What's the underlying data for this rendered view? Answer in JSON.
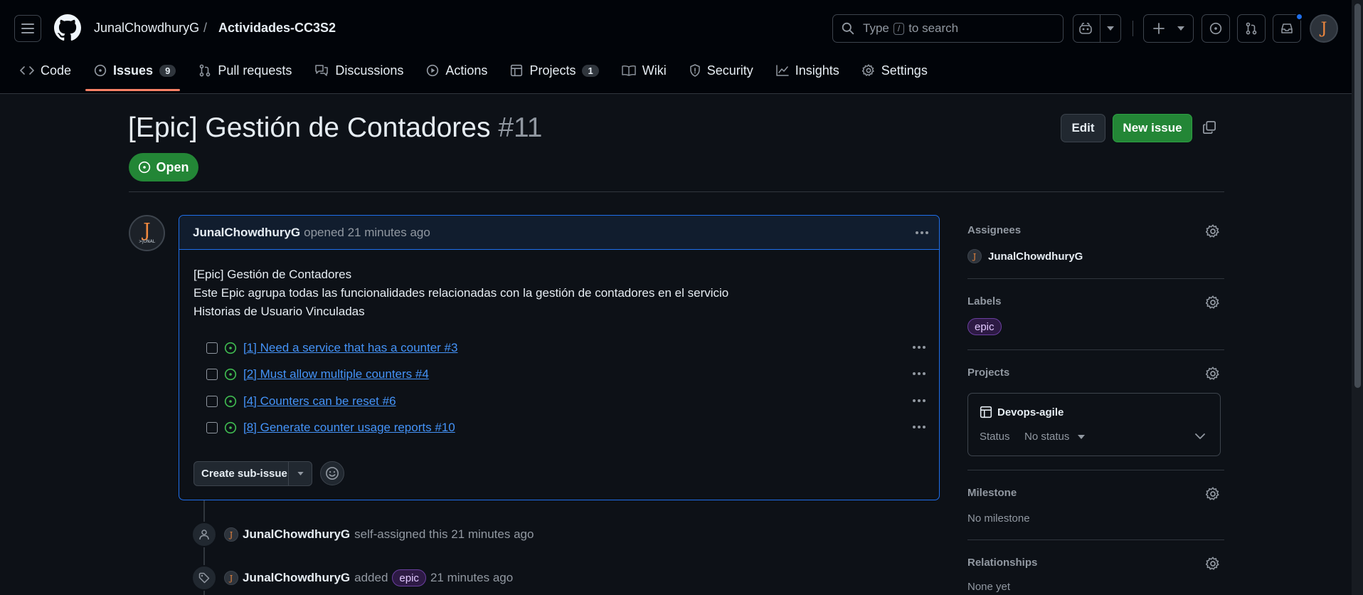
{
  "header": {
    "owner": "JunalChowdhuryG",
    "separator": "/",
    "repo": "Actividades-CC3S2",
    "search_prefix": "Type",
    "search_key": "/",
    "search_suffix": "to search"
  },
  "tabs": [
    {
      "label": "Code",
      "icon": "code-icon"
    },
    {
      "label": "Issues",
      "count": "9",
      "icon": "issue-open-icon",
      "active": true
    },
    {
      "label": "Pull requests",
      "icon": "pull-request-icon"
    },
    {
      "label": "Discussions",
      "icon": "discussion-icon"
    },
    {
      "label": "Actions",
      "icon": "play-icon"
    },
    {
      "label": "Projects",
      "count": "1",
      "icon": "table-icon"
    },
    {
      "label": "Wiki",
      "icon": "book-icon"
    },
    {
      "label": "Security",
      "icon": "shield-icon"
    },
    {
      "label": "Insights",
      "icon": "graph-icon"
    },
    {
      "label": "Settings",
      "icon": "gear-icon"
    }
  ],
  "issue": {
    "title": "[Epic] Gestión de Contadores",
    "number": "#11",
    "state": "Open",
    "edit_label": "Edit",
    "new_issue_label": "New issue"
  },
  "comment": {
    "author": "JunalChowdhuryG",
    "meta": "opened 21 minutes ago",
    "avatar_letter": "J",
    "avatar_sub": ">JUNAL",
    "lines": [
      "[Epic] Gestión de Contadores",
      "Este Epic agrupa todas las funcionalidades relacionadas con la gestión de contadores en el servicio",
      "Historias de Usuario Vinculadas"
    ],
    "tasks": [
      "[1] Need a service that has a counter #3",
      "[2] Must allow multiple counters #4",
      "[4] Counters can be reset #6",
      "[8] Generate counter usage reports #10"
    ],
    "create_sub_issue_label": "Create sub-issue"
  },
  "timeline": [
    {
      "author": "JunalChowdhuryG",
      "action": "self-assigned this 21 minutes ago"
    },
    {
      "author": "JunalChowdhuryG",
      "action_before": "added",
      "label": "epic",
      "action_after": "21 minutes ago"
    }
  ],
  "sidebar": {
    "assignees_title": "Assignees",
    "assignee": "JunalChowdhuryG",
    "labels_title": "Labels",
    "label": "epic",
    "projects_title": "Projects",
    "project_name": "Devops-agile",
    "status_label": "Status",
    "status_value": "No status",
    "milestone_title": "Milestone",
    "milestone_value": "No milestone",
    "relationships_title": "Relationships",
    "relationships_value": "None yet"
  },
  "colors": {
    "background": "#0d1117",
    "header": "#010409",
    "accent_blue": "#4493f8",
    "open_green": "#238636",
    "tab_underline": "#f78166",
    "label_epic": "#6b3fa0"
  }
}
